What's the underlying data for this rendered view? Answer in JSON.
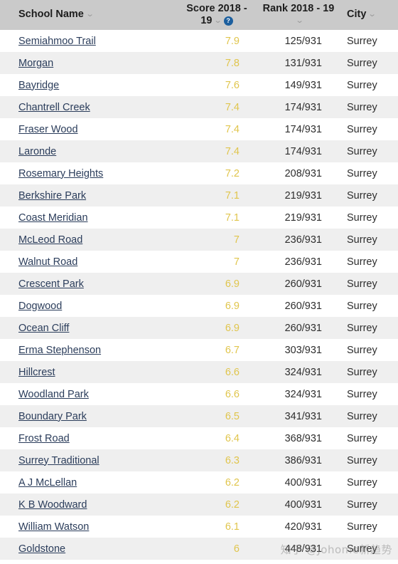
{
  "table": {
    "columns": [
      {
        "key": "name",
        "label": "School Name",
        "sortable": true,
        "has_help": false
      },
      {
        "key": "score",
        "label": "Score 2018 - 19",
        "sortable": true,
        "has_help": true
      },
      {
        "key": "rank",
        "label": "Rank 2018 - 19",
        "sortable": true,
        "has_help": false
      },
      {
        "key": "city",
        "label": "City",
        "sortable": true,
        "has_help": false
      }
    ],
    "sort_chevron": "⌄",
    "help_glyph": "?",
    "rows": [
      {
        "name": "Semiahmoo Trail",
        "score": "7.9",
        "rank": "125/931",
        "city": "Surrey"
      },
      {
        "name": "Morgan",
        "score": "7.8",
        "rank": "131/931",
        "city": "Surrey"
      },
      {
        "name": "Bayridge",
        "score": "7.6",
        "rank": "149/931",
        "city": "Surrey"
      },
      {
        "name": "Chantrell Creek",
        "score": "7.4",
        "rank": "174/931",
        "city": "Surrey"
      },
      {
        "name": "Fraser Wood",
        "score": "7.4",
        "rank": "174/931",
        "city": "Surrey"
      },
      {
        "name": "Laronde",
        "score": "7.4",
        "rank": "174/931",
        "city": "Surrey"
      },
      {
        "name": "Rosemary Heights",
        "score": "7.2",
        "rank": "208/931",
        "city": "Surrey"
      },
      {
        "name": "Berkshire Park",
        "score": "7.1",
        "rank": "219/931",
        "city": "Surrey"
      },
      {
        "name": "Coast Meridian",
        "score": "7.1",
        "rank": "219/931",
        "city": "Surrey"
      },
      {
        "name": "McLeod Road",
        "score": "7",
        "rank": "236/931",
        "city": "Surrey"
      },
      {
        "name": "Walnut Road",
        "score": "7",
        "rank": "236/931",
        "city": "Surrey"
      },
      {
        "name": "Crescent Park",
        "score": "6.9",
        "rank": "260/931",
        "city": "Surrey"
      },
      {
        "name": "Dogwood",
        "score": "6.9",
        "rank": "260/931",
        "city": "Surrey"
      },
      {
        "name": "Ocean Cliff",
        "score": "6.9",
        "rank": "260/931",
        "city": "Surrey"
      },
      {
        "name": "Erma Stephenson",
        "score": "6.7",
        "rank": "303/931",
        "city": "Surrey"
      },
      {
        "name": "Hillcrest",
        "score": "6.6",
        "rank": "324/931",
        "city": "Surrey"
      },
      {
        "name": "Woodland Park",
        "score": "6.6",
        "rank": "324/931",
        "city": "Surrey"
      },
      {
        "name": "Boundary Park",
        "score": "6.5",
        "rank": "341/931",
        "city": "Surrey"
      },
      {
        "name": "Frost Road",
        "score": "6.4",
        "rank": "368/931",
        "city": "Surrey"
      },
      {
        "name": "Surrey Traditional",
        "score": "6.3",
        "rank": "386/931",
        "city": "Surrey"
      },
      {
        "name": "A J McLellan",
        "score": "6.2",
        "rank": "400/931",
        "city": "Surrey"
      },
      {
        "name": "K B Woodward",
        "score": "6.2",
        "rank": "400/931",
        "city": "Surrey"
      },
      {
        "name": "William Watson",
        "score": "6.1",
        "rank": "420/931",
        "city": "Surrey"
      },
      {
        "name": "Goldstone",
        "score": "6",
        "rank": "448/931",
        "city": "Surrey"
      }
    ]
  },
  "watermark": {
    "text": "知乎 @Johome新趋势"
  },
  "colors": {
    "header_bg": "#cacaca",
    "row_odd_bg": "#ffffff",
    "row_even_bg": "#efefef",
    "link": "#2b3d5b",
    "score": "#e0c54c",
    "help_badge": "#1c5f9e",
    "text": "#2e2e2e"
  }
}
